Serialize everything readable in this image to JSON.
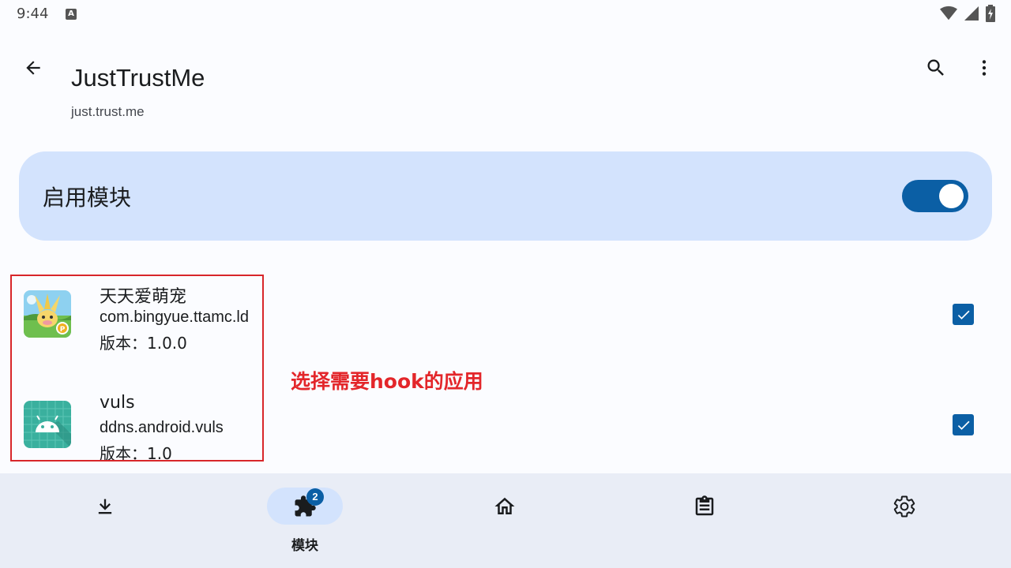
{
  "status_bar": {
    "time": "9:44",
    "notification_icon": "A",
    "icons": [
      "wifi-icon",
      "signal-icon",
      "battery-charging-icon"
    ]
  },
  "app_bar": {
    "title": "JustTrustMe",
    "subtitle": "just.trust.me",
    "icons": [
      "back-arrow-icon",
      "search-icon",
      "more-vert-icon"
    ]
  },
  "enable_card": {
    "label": "启用模块",
    "enabled": true
  },
  "apps": [
    {
      "name": "天天爱萌宠",
      "package": "com.bingyue.ttamc.ld",
      "version": "版本：1.0.0",
      "checked": true,
      "icon": "pet-game-icon"
    },
    {
      "name": "vuls",
      "package": "ddns.android.vuls",
      "version": "版本：1.0",
      "checked": true,
      "icon": "android-icon"
    }
  ],
  "annotation": {
    "text": "选择需要hook的应用"
  },
  "bottom_nav": {
    "items": [
      {
        "icon": "download-icon",
        "label": ""
      },
      {
        "icon": "puzzle-icon",
        "label": "模块",
        "badge": "2",
        "active": true
      },
      {
        "icon": "home-icon",
        "label": ""
      },
      {
        "icon": "clipboard-icon",
        "label": ""
      },
      {
        "icon": "gear-icon",
        "label": ""
      }
    ]
  },
  "colors": {
    "accent": "#0b5fa5",
    "card_bg": "#d3e3fd",
    "nav_bg": "#e9edf6",
    "annotation": "#e3262a"
  }
}
